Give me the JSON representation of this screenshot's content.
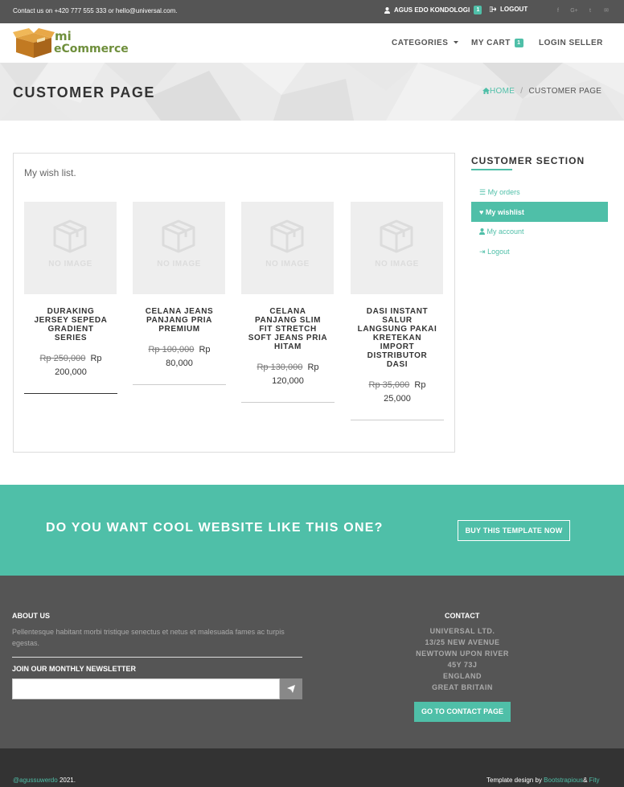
{
  "topbar": {
    "contact": "Contact us on +420 777 555 333 or hello@universal.com.",
    "user_name": "AGUS EDO KONDOLOGI",
    "user_badge": "1",
    "logout": "LOGOUT",
    "social_icons": [
      "facebook-icon",
      "google-plus-icon",
      "twitter-icon",
      "mail-icon"
    ],
    "social_glyphs": [
      "f",
      "G+",
      "t",
      "✉"
    ]
  },
  "logo": {
    "line1": "mi",
    "line2": "eCommerce"
  },
  "nav": {
    "categories": "CATEGORIES",
    "cart": "MY CART",
    "cart_badge": "1",
    "login_seller": "LOGIN SELLER"
  },
  "heading": {
    "title": "CUSTOMER PAGE",
    "breadcrumb_home": "HOME",
    "breadcrumb_current": "CUSTOMER PAGE"
  },
  "wishlist": {
    "lead": "My wish list.",
    "no_image": "NO IMAGE",
    "products": [
      {
        "name": "DURAKING JERSEY SEPEDA GRADIENT SERIES",
        "old_price": "Rp 250,000",
        "price_prefix": "Rp",
        "price": "200,000"
      },
      {
        "name": "CELANA JEANS PANJANG PRIA PREMIUM",
        "old_price": "Rp 100,000",
        "price_prefix": "Rp",
        "price": "80,000"
      },
      {
        "name": "CELANA PANJANG SLIM FIT STRETCH SOFT JEANS PRIA HITAM",
        "old_price": "Rp 130,000",
        "price_prefix": "Rp",
        "price": "120,000"
      },
      {
        "name": "DASI INSTANT SALUR LANGSUNG PAKAI KRETEKAN IMPORT DISTRIBUTOR DASI",
        "old_price": "Rp 35,000",
        "price_prefix": "Rp",
        "price": "25,000"
      }
    ]
  },
  "sidebar": {
    "title": "CUSTOMER SECTION",
    "items": [
      {
        "label": "My orders",
        "icon": "list-icon",
        "glyph": "☰"
      },
      {
        "label": "My wishlist",
        "icon": "heart-icon",
        "glyph": "♥"
      },
      {
        "label": "My account",
        "icon": "user-icon",
        "glyph": "👤"
      },
      {
        "label": "Logout",
        "icon": "sign-out-icon",
        "glyph": "⇥"
      }
    ]
  },
  "cta": {
    "text": "DO YOU WANT COOL WEBSITE LIKE THIS ONE?",
    "button": "BUY THIS TEMPLATE NOW"
  },
  "footer": {
    "about_title": "ABOUT US",
    "about_text": "Pellentesque habitant morbi tristique senectus et netus et malesuada fames ac turpis egestas.",
    "newsletter_title": "JOIN OUR MONTHLY NEWSLETTER",
    "newsletter_value": "",
    "contact_title": "CONTACT",
    "address": [
      "UNIVERSAL LTD.",
      "13/25 NEW AVENUE",
      "NEWTOWN UPON RIVER",
      "45Y 73J",
      "ENGLAND",
      "GREAT BRITAIN"
    ],
    "contact_button": "GO TO CONTACT PAGE"
  },
  "copyright": {
    "handle": "@agussuwerdo",
    "year": "2021.",
    "design_prefix": "Template design by",
    "design_by": "Bootstrapious",
    "design_sep": "&",
    "design_by2": "Fity"
  },
  "colors": {
    "accent": "#4fbfa8",
    "dark": "#555555",
    "darker": "#333333"
  }
}
